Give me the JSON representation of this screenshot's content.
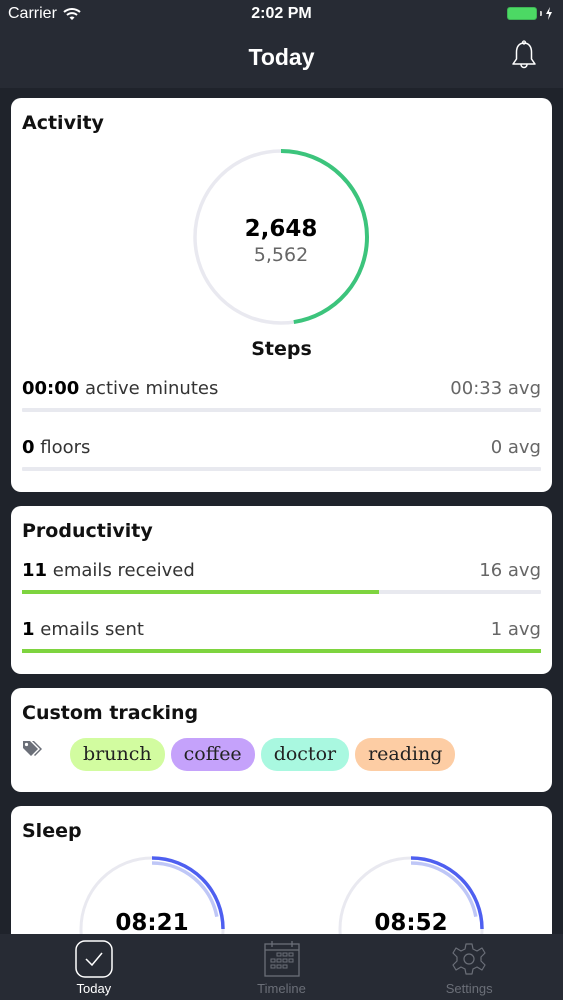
{
  "status_bar": {
    "carrier": "Carrier",
    "time": "2:02 PM",
    "battery_level": 1.0,
    "charging": true
  },
  "nav": {
    "title": "Today",
    "bell_icon": "bell-icon"
  },
  "activity": {
    "title": "Activity",
    "steps": {
      "value": "2,648",
      "goal": "5,562",
      "label": "Steps",
      "progress": 0.476,
      "color": "#3cc47c"
    },
    "metrics": [
      {
        "value": "00:00",
        "label": "active minutes",
        "avg": "00:33 avg",
        "progress": 0
      },
      {
        "value": "0",
        "label": "floors",
        "avg": "0 avg",
        "progress": 0
      }
    ]
  },
  "productivity": {
    "title": "Productivity",
    "metrics": [
      {
        "value": "11",
        "label": "emails received",
        "avg": "16 avg",
        "progress": 0.688
      },
      {
        "value": "1",
        "label": "emails sent",
        "avg": "1 avg",
        "progress": 1.0
      }
    ],
    "bar_color": "#7ed43f"
  },
  "custom_tracking": {
    "title": "Custom tracking",
    "tags": [
      {
        "label": "brunch",
        "color": "#d2fca0"
      },
      {
        "label": "coffee",
        "color": "#c5a2fb"
      },
      {
        "label": "doctor",
        "color": "#a9f8e0"
      },
      {
        "label": "reading",
        "color": "#fdcda4"
      }
    ]
  },
  "sleep": {
    "title": "Sleep",
    "rings": [
      {
        "value": "08:21",
        "progress": 0.25,
        "secondary_progress": 0.22
      },
      {
        "value": "08:52",
        "progress": 0.25,
        "secondary_progress": 0.22
      }
    ],
    "color": "#4e5ff0",
    "secondary_color": "#bfc7f7"
  },
  "tabbar": {
    "tabs": [
      {
        "label": "Today",
        "icon": "checkmark-icon",
        "active": true
      },
      {
        "label": "Timeline",
        "icon": "calendar-icon",
        "active": false
      },
      {
        "label": "Settings",
        "icon": "gear-icon",
        "active": false
      }
    ]
  }
}
